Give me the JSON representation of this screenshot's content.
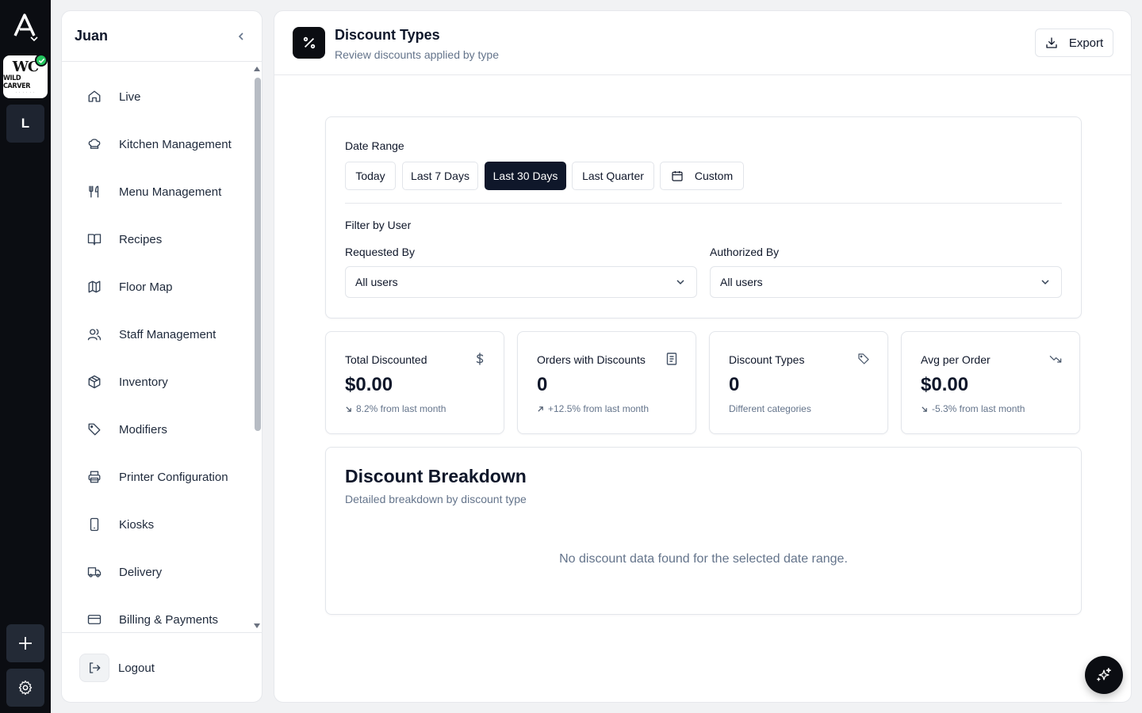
{
  "rail": {
    "brand_monogram": "WC",
    "brand_name": "WILD CARVER",
    "workspace_letter": "L"
  },
  "sidebar": {
    "user_name": "Juan",
    "items": [
      {
        "label": "Live",
        "icon": "home-icon"
      },
      {
        "label": "Kitchen Management",
        "icon": "chef-hat-icon"
      },
      {
        "label": "Menu Management",
        "icon": "utensils-icon"
      },
      {
        "label": "Recipes",
        "icon": "book-open-icon"
      },
      {
        "label": "Floor Map",
        "icon": "map-icon"
      },
      {
        "label": "Staff Management",
        "icon": "users-icon"
      },
      {
        "label": "Inventory",
        "icon": "package-icon"
      },
      {
        "label": "Modifiers",
        "icon": "tag-icon"
      },
      {
        "label": "Printer Configuration",
        "icon": "printer-icon"
      },
      {
        "label": "Kiosks",
        "icon": "tablet-icon"
      },
      {
        "label": "Delivery",
        "icon": "truck-icon"
      },
      {
        "label": "Billing & Payments",
        "icon": "credit-card-icon"
      }
    ],
    "logout_label": "Logout"
  },
  "header": {
    "title": "Discount Types",
    "subtitle": "Review discounts applied by type",
    "export_label": "Export"
  },
  "filters": {
    "date_range_label": "Date Range",
    "ranges": [
      "Today",
      "Last 7 Days",
      "Last 30 Days",
      "Last Quarter",
      "Custom"
    ],
    "active_range": "Last 30 Days",
    "filter_by_user_label": "Filter by User",
    "requested_by_label": "Requested By",
    "requested_by_value": "All users",
    "authorized_by_label": "Authorized By",
    "authorized_by_value": "All users"
  },
  "stats": [
    {
      "title": "Total Discounted",
      "value": "$0.00",
      "note": "8.2% from last month",
      "trend": "down",
      "icon": "dollar-icon"
    },
    {
      "title": "Orders with Discounts",
      "value": "0",
      "note": "+12.5% from last month",
      "trend": "up",
      "icon": "receipt-icon"
    },
    {
      "title": "Discount Types",
      "value": "0",
      "note": "Different categories",
      "trend": "none",
      "icon": "tag-icon"
    },
    {
      "title": "Avg per Order",
      "value": "$0.00",
      "note": "-5.3% from last month",
      "trend": "down",
      "icon": "trending-down-icon"
    }
  ],
  "breakdown": {
    "title": "Discount Breakdown",
    "subtitle": "Detailed breakdown by discount type",
    "empty_message": "No discount data found for the selected date range."
  },
  "colors": {
    "accent": "#0f172a",
    "rail_bg": "#0b0d12",
    "muted_text": "#64748b",
    "success": "#22c55e"
  }
}
